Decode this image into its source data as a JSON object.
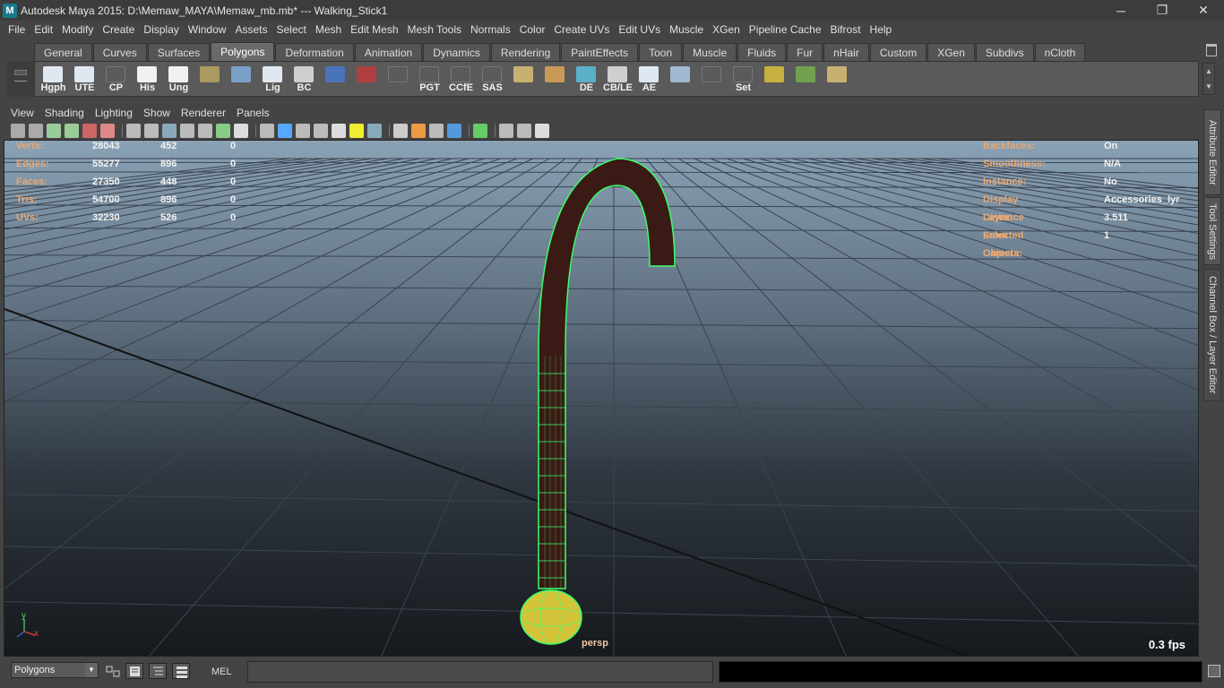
{
  "window": {
    "title": "Autodesk Maya 2015: D:\\Memaw_MAYA\\Memaw_mb.mb*   ---   Walking_Stick1",
    "logo": "M",
    "minimize": "─",
    "maximize": "❐",
    "close": "✕"
  },
  "menubar": [
    "File",
    "Edit",
    "Modify",
    "Create",
    "Display",
    "Window",
    "Assets",
    "Select",
    "Mesh",
    "Edit Mesh",
    "Mesh Tools",
    "Normals",
    "Color",
    "Create UVs",
    "Edit UVs",
    "Muscle",
    "XGen",
    "Pipeline Cache",
    "Bifrost",
    "Help"
  ],
  "shelf_tabs": [
    "General",
    "Curves",
    "Surfaces",
    "Polygons",
    "Deformation",
    "Animation",
    "Dynamics",
    "Rendering",
    "PaintEffects",
    "Toon",
    "Muscle",
    "Fluids",
    "Fur",
    "nHair",
    "Custom",
    "XGen",
    "Subdivs",
    "nCloth"
  ],
  "shelf_active_tab": "Polygons",
  "shelf_buttons": [
    {
      "label": "Hgph",
      "icon": "hypergraph-icon",
      "color": "#dfe8f0"
    },
    {
      "label": "UTE",
      "icon": "uv-texture-editor-icon",
      "color": "#dfe8f0"
    },
    {
      "label": "CP",
      "icon": "component-pivot-icon",
      "color": "#5a5a5a"
    },
    {
      "label": "His",
      "icon": "history-icon",
      "color": "#f0f0f0"
    },
    {
      "label": "Ung",
      "icon": "ungroup-icon",
      "color": "#f0f0f0"
    },
    {
      "label": "",
      "icon": "book-icon",
      "color": "#a89a60"
    },
    {
      "label": "",
      "icon": "magnifier-icon",
      "color": "#7aa0c8"
    },
    {
      "label": "Lig",
      "icon": "light-editor-icon",
      "color": "#dfe8f0"
    },
    {
      "label": "BC",
      "icon": "eye-icon",
      "color": "#cfcfcf"
    },
    {
      "label": "",
      "icon": "lattice-icon",
      "color": "#4a74b8"
    },
    {
      "label": "",
      "icon": "camera-rig-icon",
      "color": "#b04040"
    },
    {
      "label": "",
      "icon": "curve-icon",
      "color": "#5a5a5a"
    },
    {
      "label": "PGT",
      "icon": "pgt-script-icon",
      "color": "#5a5a5a"
    },
    {
      "label": "CCfE",
      "icon": "ccfe-script-icon",
      "color": "#5a5a5a"
    },
    {
      "label": "SAS",
      "icon": "sas-script-icon",
      "color": "#5a5a5a"
    },
    {
      "label": "",
      "icon": "uv-layout-icon",
      "color": "#c8b070"
    },
    {
      "label": "",
      "icon": "uv-tile-icon",
      "color": "#c89a58"
    },
    {
      "label": "DE",
      "icon": "display-layer-icon",
      "color": "#5ab0c8"
    },
    {
      "label": "CB/LE",
      "icon": "channel-box-icon",
      "color": "#cfcfcf"
    },
    {
      "label": "AE",
      "icon": "attribute-editor-icon",
      "color": "#dfe8f0"
    },
    {
      "label": "",
      "icon": "spotlight-icon",
      "color": "#a0b8d0"
    },
    {
      "label": "",
      "icon": "cv-curve-icon",
      "color": "#5a5a5a"
    },
    {
      "label": "Set",
      "icon": "key-set-icon",
      "color": "#5a5a5a"
    },
    {
      "label": "",
      "icon": "pivot-target-icon",
      "color": "#c8b040"
    },
    {
      "label": "",
      "icon": "rotate-manip-icon",
      "color": "#70a050"
    },
    {
      "label": "",
      "icon": "uv-snapshot-icon",
      "color": "#c8b070"
    }
  ],
  "panel_menu": [
    "View",
    "Shading",
    "Lighting",
    "Show",
    "Renderer",
    "Panels"
  ],
  "hud_left": [
    {
      "label": "Verts:",
      "v1": "28043",
      "v2": "452",
      "v3": "0"
    },
    {
      "label": "Edges:",
      "v1": "55277",
      "v2": "896",
      "v3": "0"
    },
    {
      "label": "Faces:",
      "v1": "27350",
      "v2": "448",
      "v3": "0"
    },
    {
      "label": "Tris:",
      "v1": "54700",
      "v2": "896",
      "v3": "0"
    },
    {
      "label": "UVs:",
      "v1": "32230",
      "v2": "526",
      "v3": "0"
    }
  ],
  "hud_right": [
    {
      "label": "Backfaces:",
      "value": "On"
    },
    {
      "label": "Smoothness:",
      "value": "N/A"
    },
    {
      "label": "Instance:",
      "value": "No"
    },
    {
      "label": "Display Layer:",
      "value": "Accessories_lyr"
    },
    {
      "label": "Distance From Camera:",
      "value": "3.511"
    },
    {
      "label": "Selected Objects:",
      "value": "1"
    }
  ],
  "viewport": {
    "camera": "persp",
    "fps": "0.3 fps",
    "axis_y": "y",
    "axis_x": "x"
  },
  "right_tabs": [
    "Attribute Editor",
    "Tool Settings",
    "Channel Box / Layer Editor"
  ],
  "bottom": {
    "menu_set": "Polygons",
    "mel_label": "MEL"
  }
}
